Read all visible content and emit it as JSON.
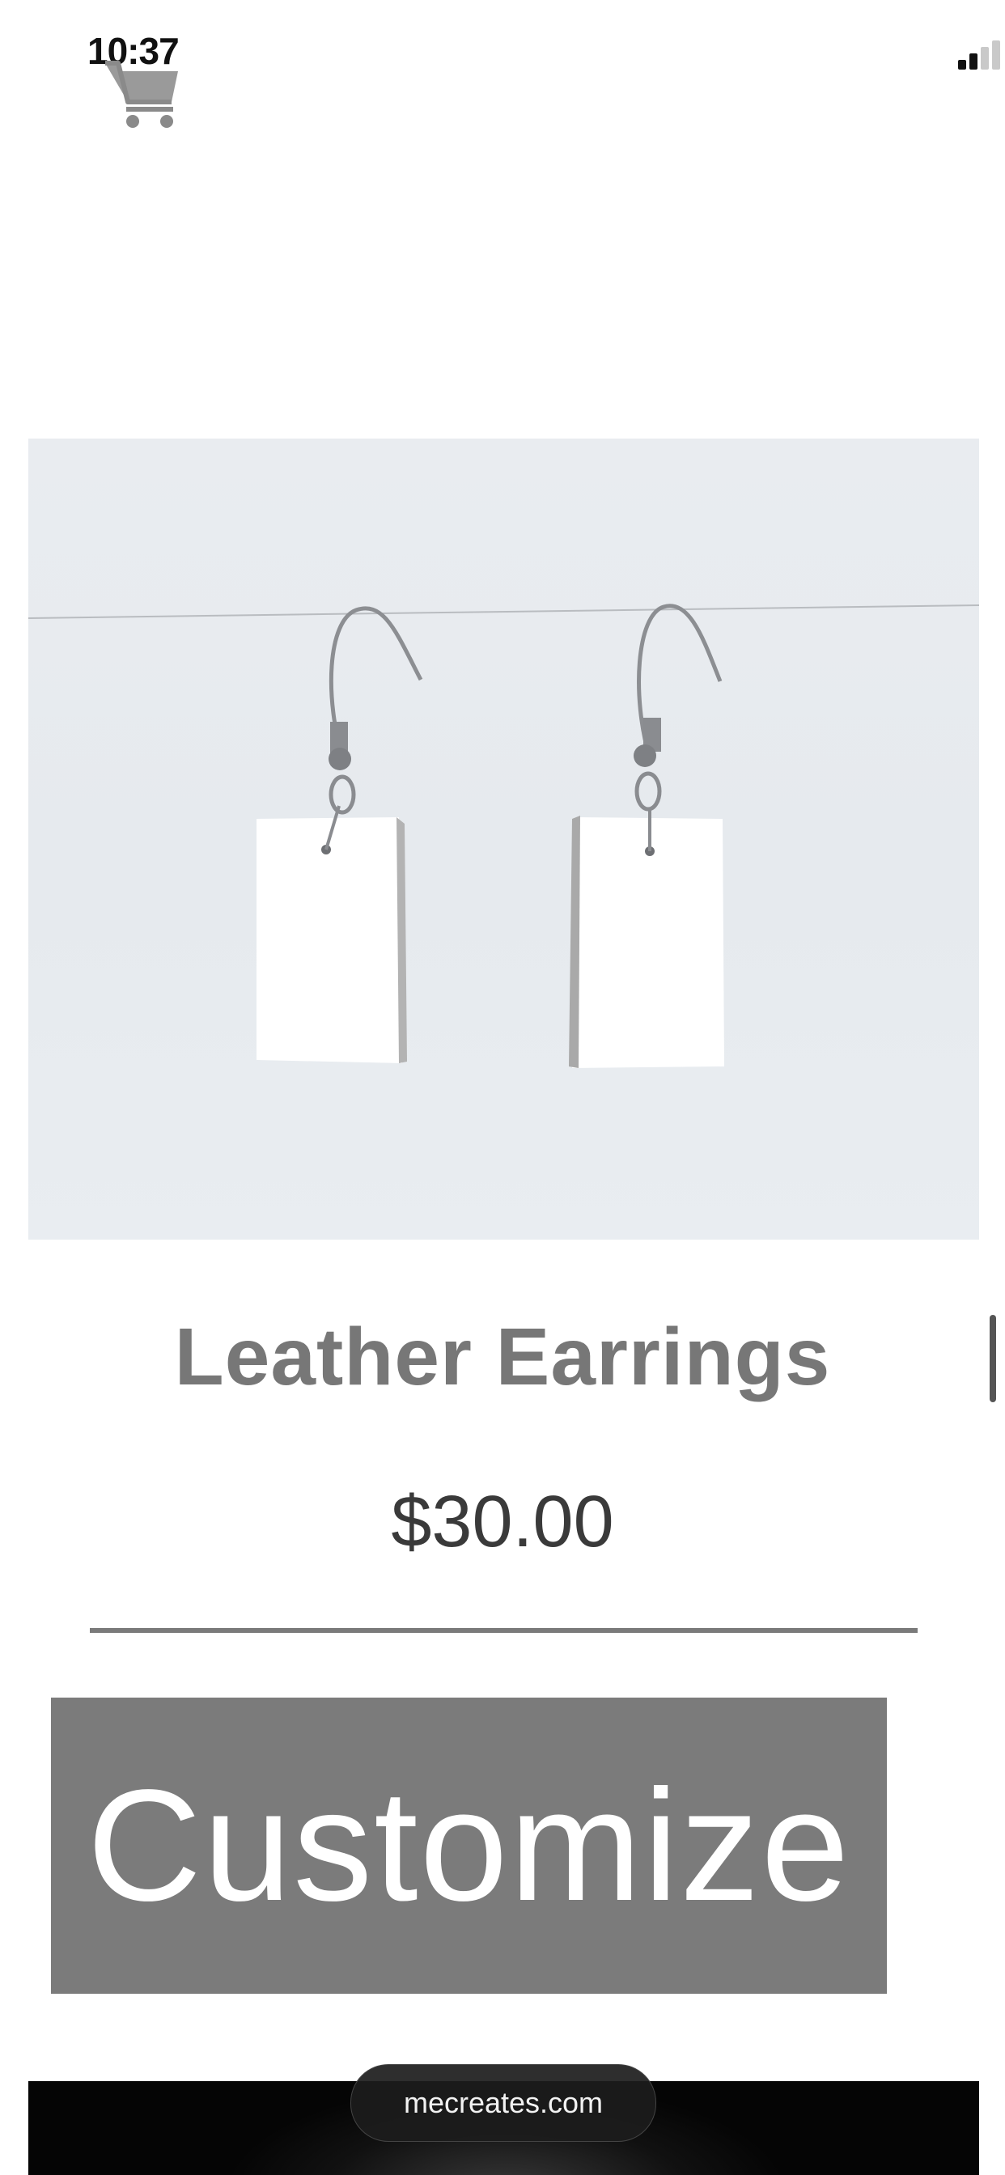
{
  "status_bar": {
    "time": "10:37",
    "icons": [
      "signal-icon",
      "wifi-icon",
      "battery-icon"
    ]
  },
  "header": {
    "cart_icon": "cart-icon"
  },
  "product": {
    "image_subject": "leather-earrings",
    "title": "Leather Earrings",
    "price": "$30.00"
  },
  "actions": {
    "customize_label": "Customize"
  },
  "browser": {
    "url": "mecreates.com"
  },
  "colors": {
    "title_gray": "#777777",
    "button_gray": "#7b7b7b",
    "divider_gray": "#7a7a7a",
    "price_text": "#3a3a3a"
  }
}
